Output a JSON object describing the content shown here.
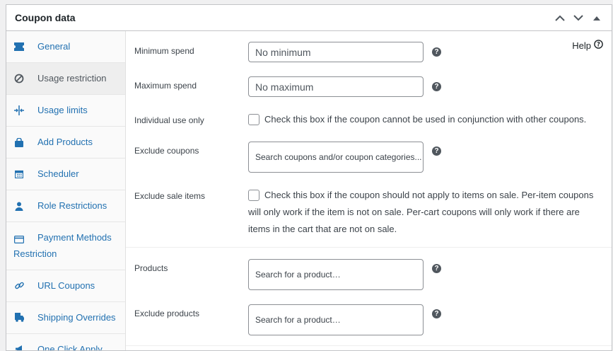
{
  "panel": {
    "title": "Coupon data"
  },
  "help": {
    "label": "Help"
  },
  "sidebar": {
    "items": [
      {
        "label": "General",
        "icon": "ticket-icon"
      },
      {
        "label": "Usage restriction",
        "icon": "block-icon"
      },
      {
        "label": "Usage limits",
        "icon": "arrows-icon"
      },
      {
        "label": "Add Products",
        "icon": "bag-icon"
      },
      {
        "label": "Scheduler",
        "icon": "calendar-icon"
      },
      {
        "label": "Role Restrictions",
        "icon": "user-icon"
      },
      {
        "label": "Payment Methods Restriction",
        "icon": "credit-card-icon"
      },
      {
        "label": "URL Coupons",
        "icon": "link-icon"
      },
      {
        "label": "Shipping Overrides",
        "icon": "truck-icon"
      },
      {
        "label": "One Click Apply",
        "icon": "megaphone-icon"
      }
    ]
  },
  "form": {
    "minimum_spend": {
      "label": "Minimum spend",
      "placeholder": "No minimum"
    },
    "maximum_spend": {
      "label": "Maximum spend",
      "placeholder": "No maximum"
    },
    "individual_use": {
      "label": "Individual use only",
      "text": "Check this box if the coupon cannot be used in conjunction with other coupons."
    },
    "exclude_coupons": {
      "label": "Exclude coupons",
      "placeholder": "Search coupons and/or coupon categories..."
    },
    "exclude_sale": {
      "label": "Exclude sale items",
      "text": "Check this box if the coupon should not apply to items on sale. Per-item coupons will only work if the item is not on sale. Per-cart coupons will only work if there are items in the cart that are not on sale."
    },
    "products": {
      "label": "Products",
      "placeholder": "Search for a product…"
    },
    "exclude_products": {
      "label": "Exclude products",
      "placeholder": "Search for a product…"
    }
  },
  "colors": {
    "accent": "#2271b1",
    "border": "#c3c4c7",
    "active_bg": "#eeeeee"
  }
}
